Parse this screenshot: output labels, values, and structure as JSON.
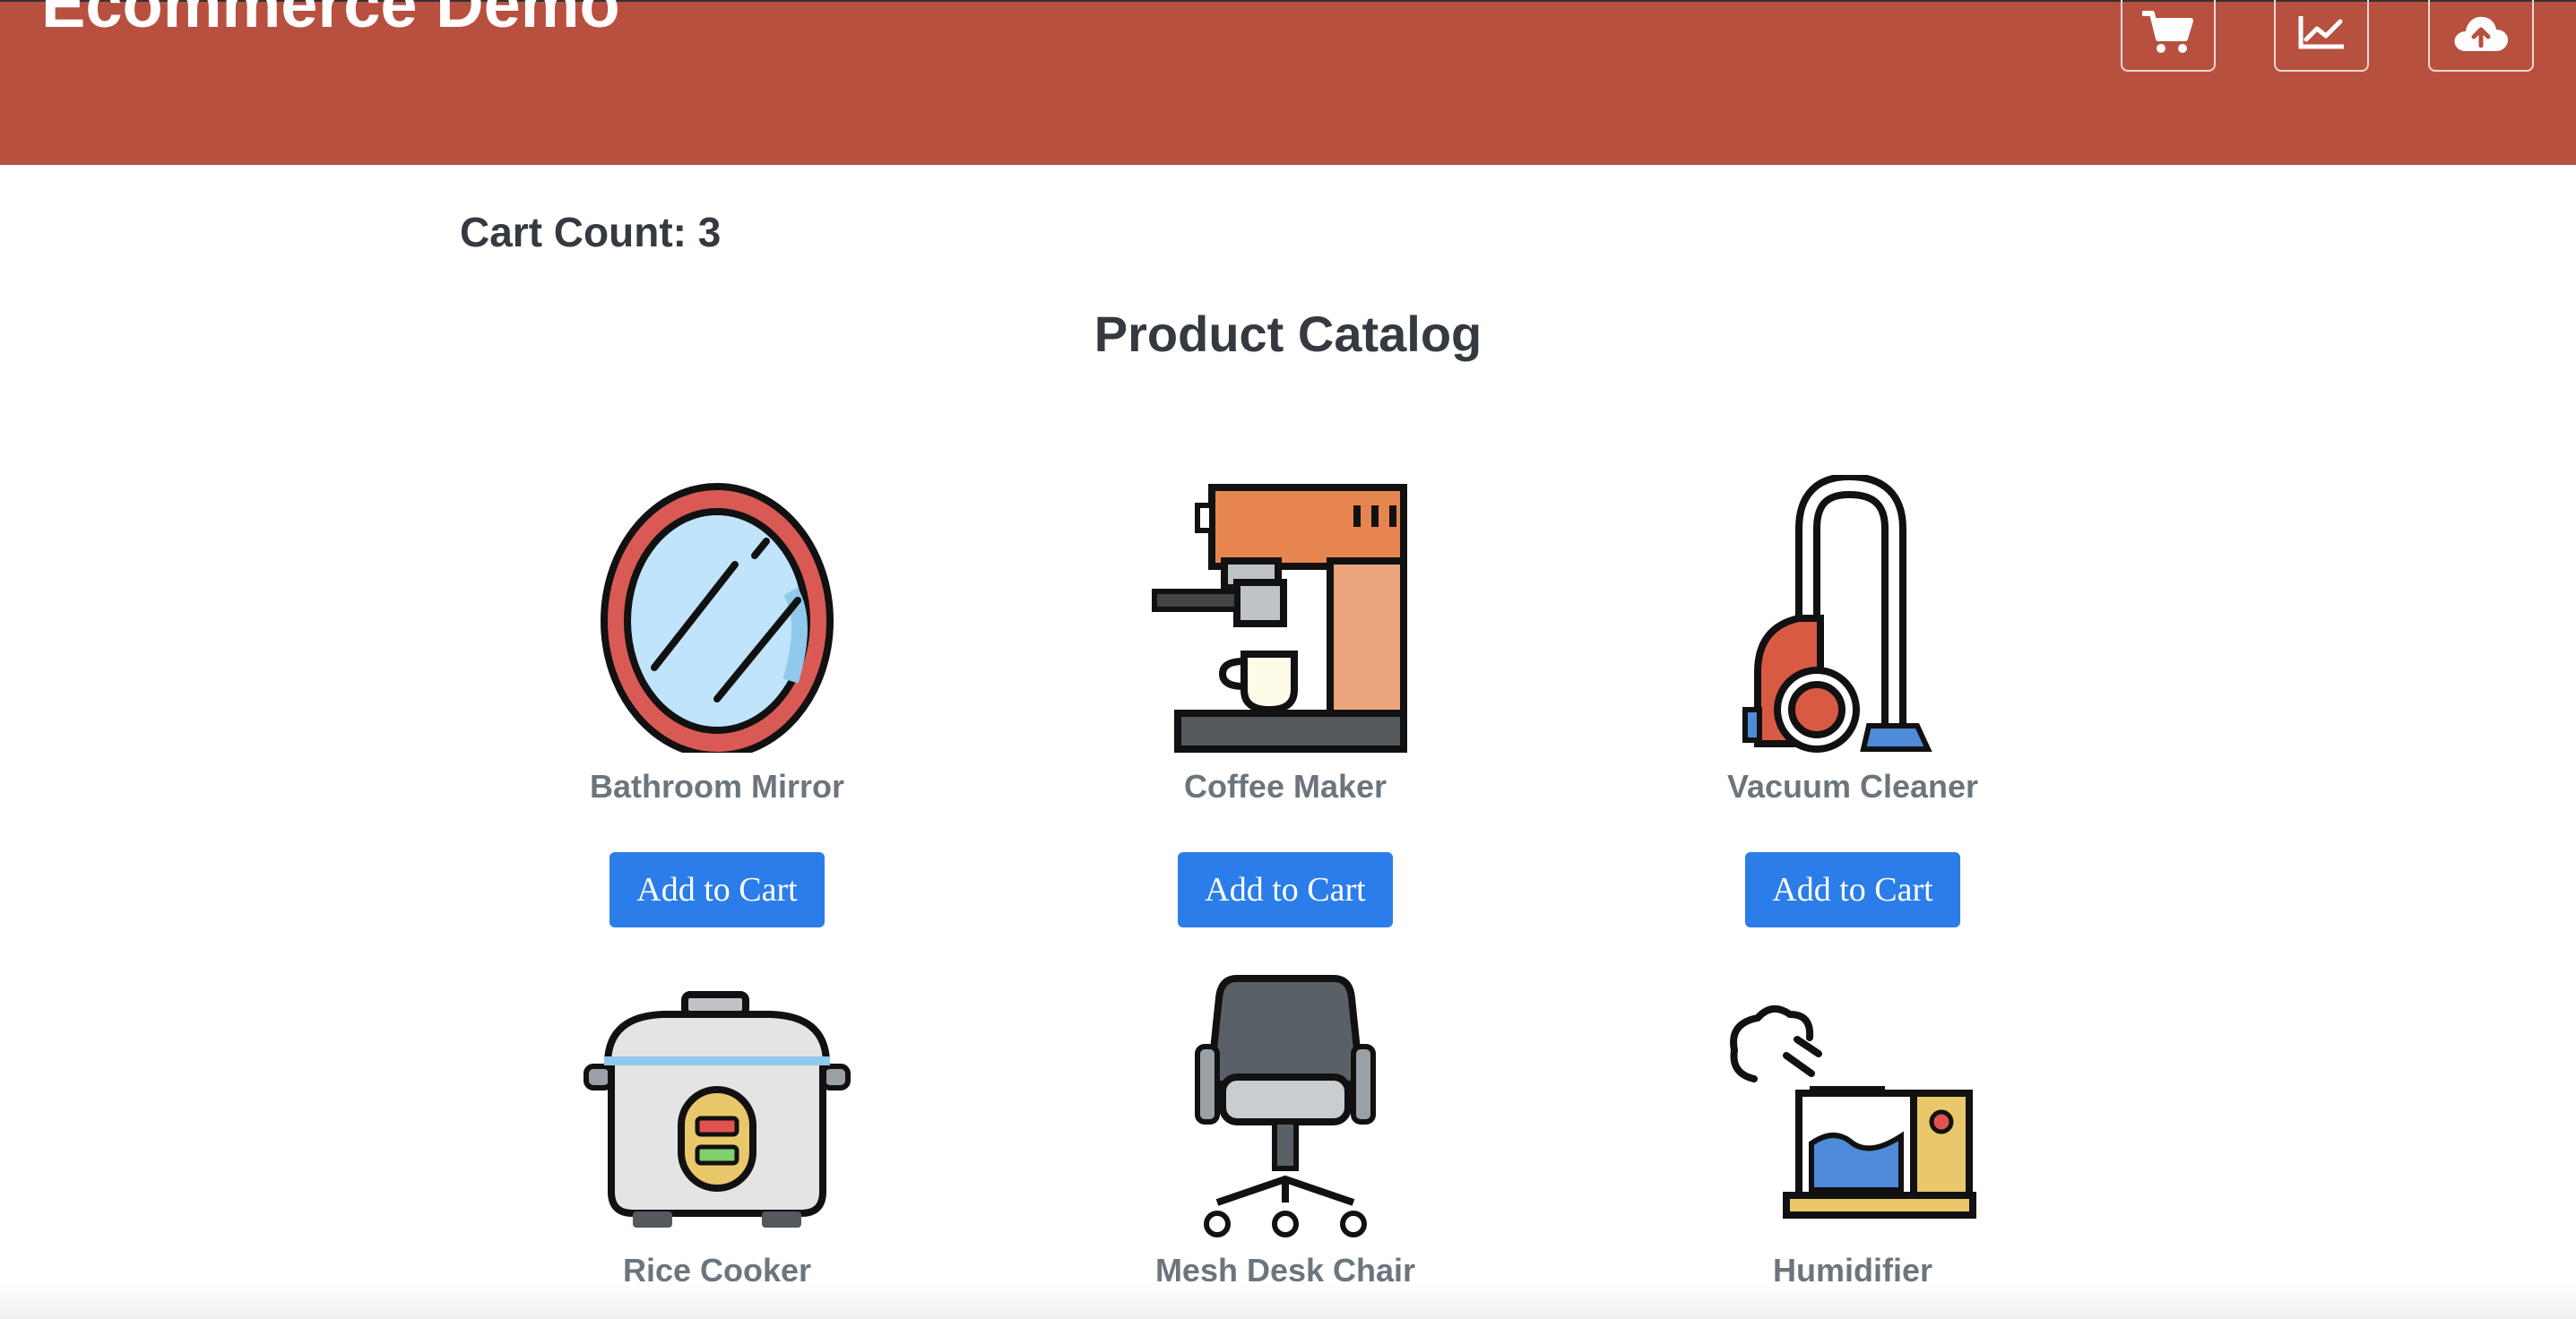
{
  "header": {
    "brand": "Ecommerce Demo",
    "buttons": [
      {
        "icon": "cart-icon"
      },
      {
        "icon": "chart-icon"
      },
      {
        "icon": "cloud-upload-icon"
      }
    ],
    "background": "#b8503f"
  },
  "cart": {
    "count_label": "Cart Count: 3"
  },
  "catalog": {
    "title": "Product Catalog",
    "products": [
      {
        "name": "Bathroom Mirror",
        "button": "Add to Cart",
        "icon": "mirror-icon"
      },
      {
        "name": "Coffee Maker",
        "button": "Add to Cart",
        "icon": "coffee-maker-icon"
      },
      {
        "name": "Vacuum Cleaner",
        "button": "Add to Cart",
        "icon": "vacuum-cleaner-icon"
      },
      {
        "name": "Rice Cooker",
        "button": "",
        "icon": "rice-cooker-icon"
      },
      {
        "name": "Mesh Desk Chair",
        "button": "",
        "icon": "desk-chair-icon"
      },
      {
        "name": "Humidifier",
        "button": "",
        "icon": "humidifier-icon"
      }
    ]
  },
  "colors": {
    "accent": "#2b7de9",
    "text": "#343a40",
    "muted": "#6c757d"
  }
}
